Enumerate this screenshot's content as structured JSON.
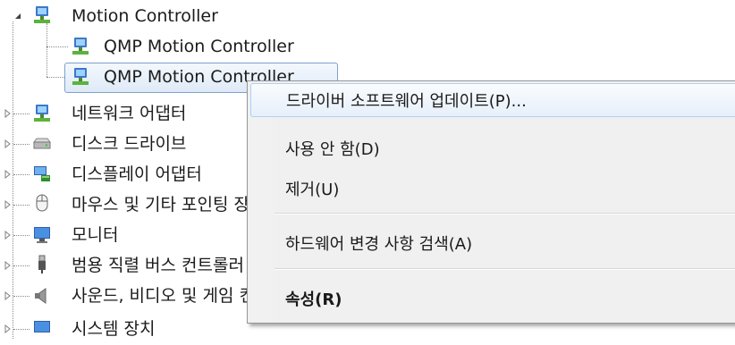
{
  "tree": {
    "parent": {
      "label": "Motion Controller"
    },
    "children": [
      {
        "label": "QMP Motion Controller"
      },
      {
        "label": "QMP Motion Controller"
      }
    ],
    "categories": [
      {
        "label": "네트워크 어댑터",
        "icon": "network-adapter-icon"
      },
      {
        "label": "디스크 드라이브",
        "icon": "disk-drive-icon"
      },
      {
        "label": "디스플레이 어댑터",
        "icon": "display-adapter-icon"
      },
      {
        "label": "마우스 및 기타 포인팅 장치",
        "icon": "mouse-icon"
      },
      {
        "label": "모니터",
        "icon": "monitor-icon"
      },
      {
        "label": "범용 직렬 버스 컨트롤러",
        "icon": "usb-icon"
      },
      {
        "label": "사운드, 비디오 및 게임 컨트롤러",
        "icon": "speaker-icon"
      },
      {
        "label": "시스템 장치",
        "icon": "system-device-icon"
      }
    ]
  },
  "context_menu": {
    "items": [
      {
        "label": "드라이버 소프트웨어 업데이트(P)...",
        "highlighted": true
      },
      {
        "label": "사용 안 함(D)"
      },
      {
        "label": "제거(U)"
      },
      {
        "label": "하드웨어 변경 사항 검색(A)"
      },
      {
        "label": "속성(R)",
        "bold": true
      }
    ]
  },
  "colors": {
    "highlight_border": "#aecff7",
    "selection_border": "#7da2ce",
    "menu_background": "#f0f0f0"
  }
}
